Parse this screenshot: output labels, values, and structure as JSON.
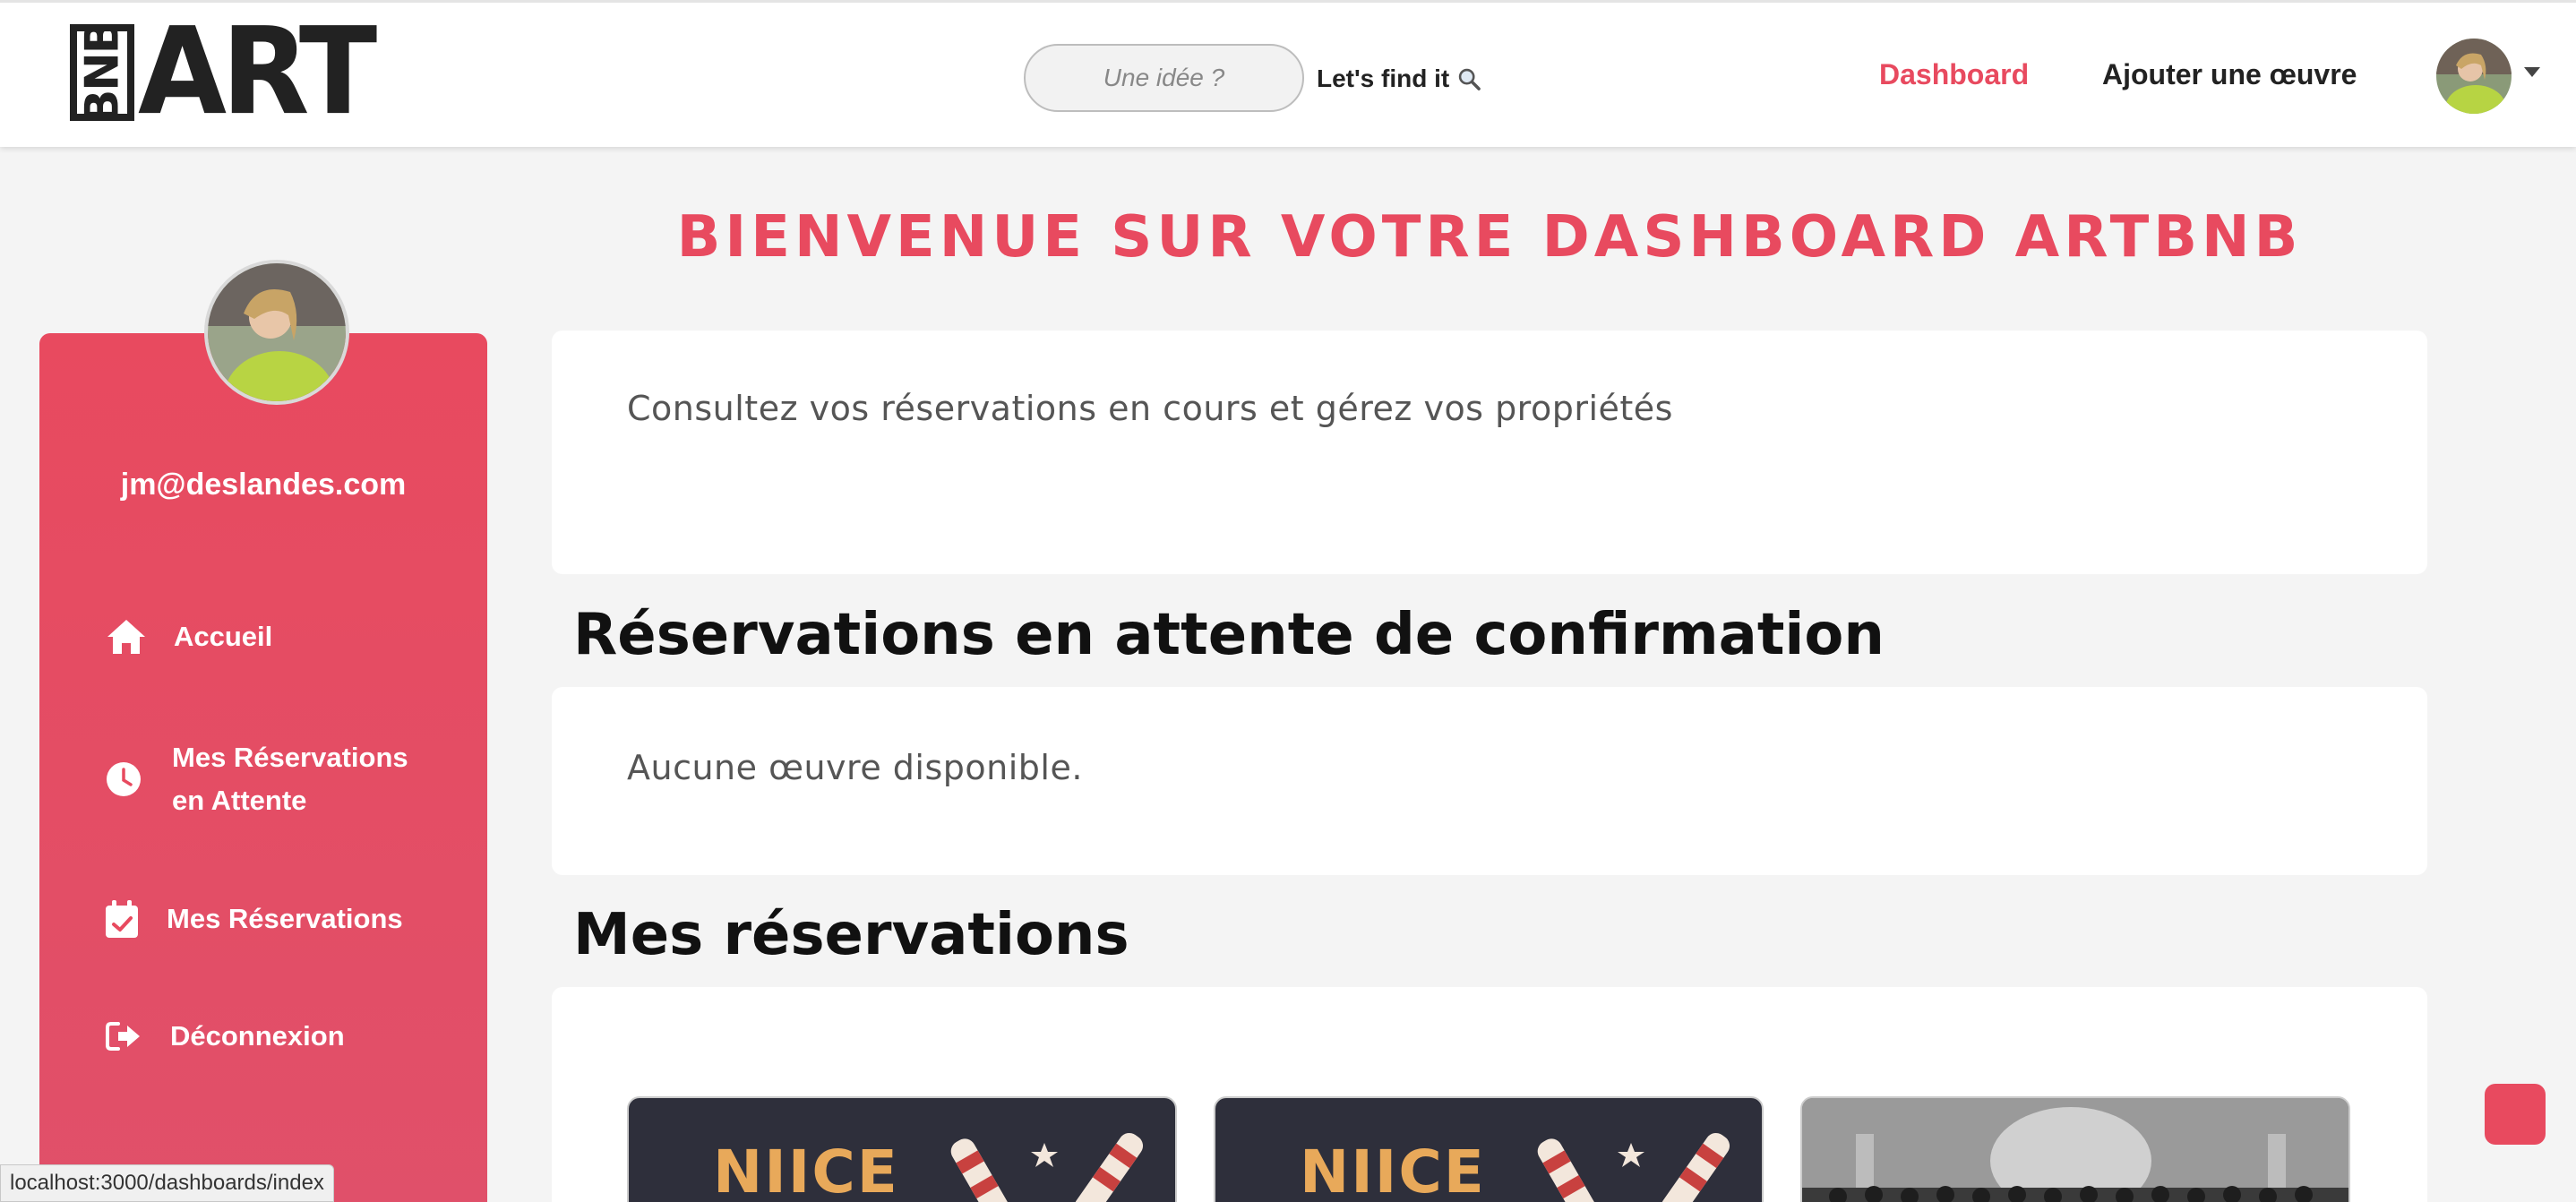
{
  "navbar": {
    "logo_small": "BNB",
    "logo_big": "ART",
    "search_placeholder": "Une idée ?",
    "search_button": "Let's find it",
    "links": {
      "dashboard": "Dashboard",
      "add": "Ajouter une œuvre"
    }
  },
  "sidebar": {
    "email": "jm@deslandes.com",
    "items": [
      {
        "label": "Accueil",
        "icon": "home-icon"
      },
      {
        "label_line1": "Mes Réservations",
        "label_line2": "en Attente",
        "icon": "clock-icon"
      },
      {
        "label": "Mes Réservations",
        "icon": "calendar-check-icon"
      },
      {
        "label": "Déconnexion",
        "icon": "logout-icon"
      }
    ]
  },
  "main": {
    "welcome": "BIENVENUE SUR VOTRE DASHBOARD ARTBNB",
    "intro": "Consultez vos réservations en cours et gérez vos propriétés",
    "pending_title": "Réservations en attente de confirmation",
    "pending_empty": "Aucune œuvre disponible.",
    "bookings_title": "Mes réservations",
    "artworks": [
      {
        "title": "NIICE"
      },
      {
        "title": "NIICE"
      },
      {
        "title": ""
      }
    ]
  },
  "status_url": "localhost:3000/dashboards/index",
  "colors": {
    "accent": "#e84a5f",
    "background": "#f4f4f4",
    "text": "#222222"
  }
}
